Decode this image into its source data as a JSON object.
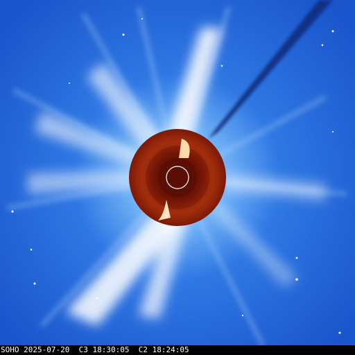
{
  "image": {
    "subject": "SOHO LASCO combined C2/C3 coronagraph view",
    "palette": {
      "background": "#1f63d8",
      "background_light": "#4f97f0",
      "streamer": "#ffffff",
      "occulter_outer": "#8a1a08",
      "occulter_inner": "#5a0e04",
      "dark_trail": "#0a2a78"
    }
  },
  "caption": {
    "observatory": "SOHO",
    "date": "2025-07-20",
    "c3_label": "C3",
    "c3_time": "18:30:05",
    "c2_label": "C2",
    "c2_time": "18:24:05"
  }
}
